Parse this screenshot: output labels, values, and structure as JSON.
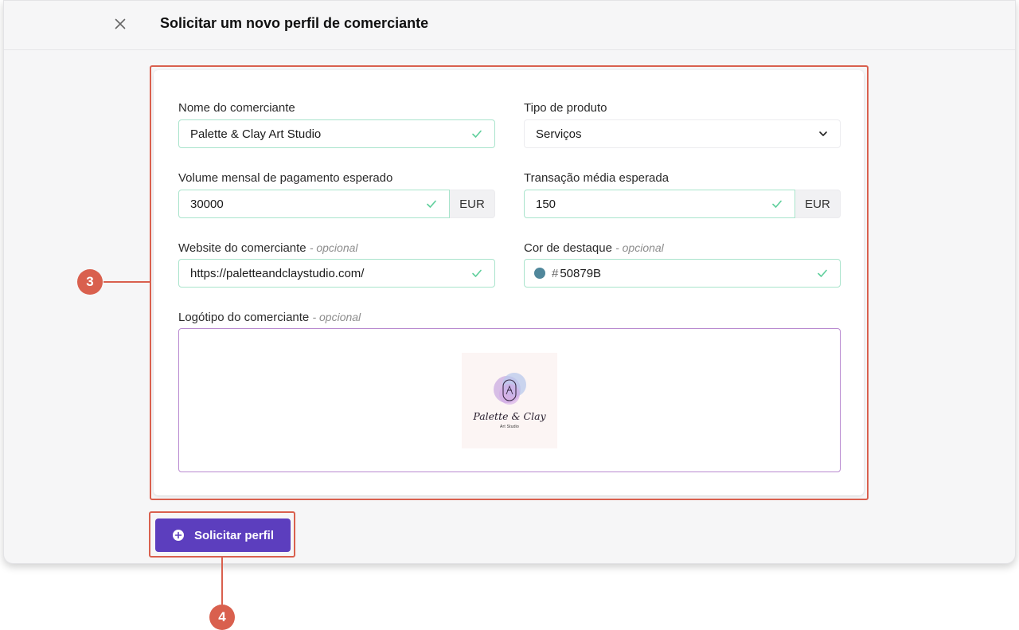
{
  "header": {
    "title": "Solicitar um novo perfil de comerciante"
  },
  "form": {
    "merchant_name": {
      "label": "Nome do comerciante",
      "value": "Palette & Clay Art Studio"
    },
    "product_type": {
      "label": "Tipo de produto",
      "value": "Serviços"
    },
    "monthly_volume": {
      "label": "Volume mensal de pagamento esperado",
      "value": "30000",
      "currency": "EUR"
    },
    "avg_transaction": {
      "label": "Transação média esperada",
      "value": "150",
      "currency": "EUR"
    },
    "website": {
      "label": "Website do comerciante",
      "optional": "- opcional",
      "value": "https://paletteandclaystudio.com/"
    },
    "highlight_color": {
      "label": "Cor de destaque",
      "optional": "- opcional",
      "hash": "#",
      "value": "50879B",
      "swatch": "#50879B"
    },
    "logo": {
      "label": "Logótipo do comerciante",
      "optional": "- opcional",
      "brand_name": "Palette & Clay",
      "brand_sub": "Art Studio"
    }
  },
  "actions": {
    "submit_label": "Solicitar perfil"
  },
  "annotations": {
    "marker_3": "3",
    "marker_4": "4",
    "color": "#d9604e"
  },
  "colors": {
    "primary": "#5c3ebe",
    "valid_border": "#a9e4cc",
    "check": "#5fcf9c"
  }
}
